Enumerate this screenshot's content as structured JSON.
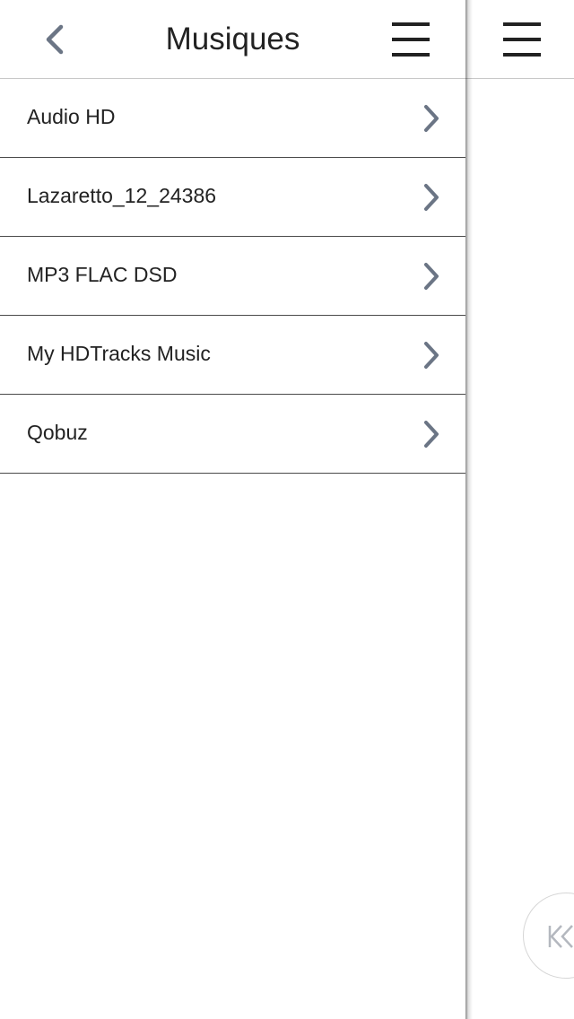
{
  "header": {
    "title": "Musiques"
  },
  "list": {
    "items": [
      {
        "label": "Audio HD"
      },
      {
        "label": "Lazaretto_12_24386"
      },
      {
        "label": "MP3 FLAC DSD"
      },
      {
        "label": "My HDTracks Music"
      },
      {
        "label": "Qobuz"
      }
    ]
  },
  "icons": {
    "back": "chevron-left-icon",
    "menu": "hamburger-menu-icon",
    "row_arrow": "chevron-right-icon",
    "previous": "skip-previous-icon"
  },
  "colors": {
    "text": "#222222",
    "chevron": "#6b7585",
    "divider": "#4a4a4a",
    "header_divider": "#c8c8c8",
    "icon_dark": "#222222",
    "button_border": "#d6d6d6",
    "button_icon": "#b4b8bf"
  }
}
